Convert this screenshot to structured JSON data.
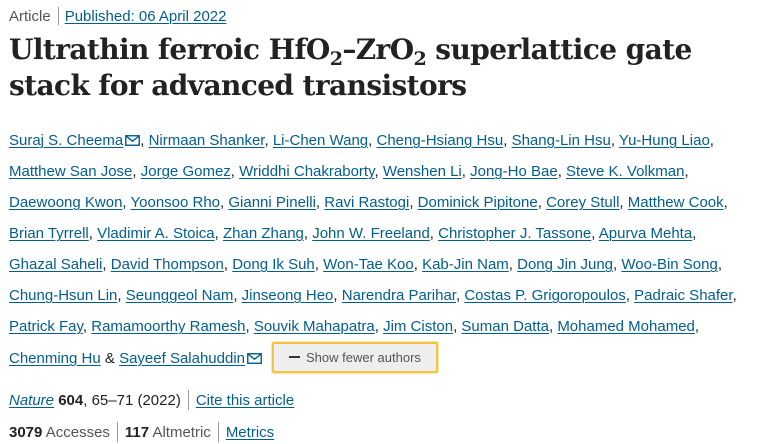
{
  "header": {
    "article_type": "Article",
    "published": "Published: 06 April 2022"
  },
  "title": {
    "part1": "Ultrathin ferroic HfO",
    "sub1": "2",
    "dash": "–",
    "part2": "ZrO",
    "sub2": "2",
    "part3": " superlattice gate stack for advanced transistors"
  },
  "authors": [
    {
      "name": "Suraj S. Cheema",
      "mail": true
    },
    {
      "name": "Nirmaan Shanker",
      "mail": false
    },
    {
      "name": "Li-Chen Wang",
      "mail": false
    },
    {
      "name": "Cheng-Hsiang Hsu",
      "mail": false
    },
    {
      "name": "Shang-Lin Hsu",
      "mail": false
    },
    {
      "name": "Yu-Hung Liao",
      "mail": false
    },
    {
      "name": "Matthew San Jose",
      "mail": false
    },
    {
      "name": "Jorge Gomez",
      "mail": false
    },
    {
      "name": "Wriddhi Chakraborty",
      "mail": false
    },
    {
      "name": "Wenshen Li",
      "mail": false
    },
    {
      "name": "Jong-Ho Bae",
      "mail": false
    },
    {
      "name": "Steve K. Volkman",
      "mail": false
    },
    {
      "name": "Daewoong Kwon",
      "mail": false
    },
    {
      "name": "Yoonsoo Rho",
      "mail": false
    },
    {
      "name": "Gianni Pinelli",
      "mail": false
    },
    {
      "name": "Ravi Rastogi",
      "mail": false
    },
    {
      "name": "Dominick Pipitone",
      "mail": false
    },
    {
      "name": "Corey Stull",
      "mail": false
    },
    {
      "name": "Matthew Cook",
      "mail": false
    },
    {
      "name": "Brian Tyrrell",
      "mail": false
    },
    {
      "name": "Vladimir A. Stoica",
      "mail": false
    },
    {
      "name": "Zhan Zhang",
      "mail": false
    },
    {
      "name": "John W. Freeland",
      "mail": false
    },
    {
      "name": "Christopher J. Tassone",
      "mail": false
    },
    {
      "name": "Apurva Mehta",
      "mail": false
    },
    {
      "name": "Ghazal Saheli",
      "mail": false
    },
    {
      "name": "David Thompson",
      "mail": false
    },
    {
      "name": "Dong Ik Suh",
      "mail": false
    },
    {
      "name": "Won-Tae Koo",
      "mail": false
    },
    {
      "name": "Kab-Jin Nam",
      "mail": false
    },
    {
      "name": "Dong Jin Jung",
      "mail": false
    },
    {
      "name": "Woo-Bin Song",
      "mail": false
    },
    {
      "name": "Chung-Hsun Lin",
      "mail": false
    },
    {
      "name": "Seunggeol Nam",
      "mail": false
    },
    {
      "name": "Jinseong Heo",
      "mail": false
    },
    {
      "name": "Narendra Parihar",
      "mail": false
    },
    {
      "name": "Costas P. Grigoropoulos",
      "mail": false
    },
    {
      "name": "Padraic Shafer",
      "mail": false
    },
    {
      "name": "Patrick Fay",
      "mail": false
    },
    {
      "name": "Ramamoorthy Ramesh",
      "mail": false
    },
    {
      "name": "Souvik Mahapatra",
      "mail": false
    },
    {
      "name": "Jim Ciston",
      "mail": false
    },
    {
      "name": "Suman Datta",
      "mail": false
    },
    {
      "name": "Mohamed Mohamed",
      "mail": false
    },
    {
      "name": "Chenming Hu",
      "mail": false
    },
    {
      "name": "Sayeef Salahuddin",
      "mail": true
    }
  ],
  "authors_separator": ",",
  "authors_final_join": "&",
  "show_fewer_label": "Show fewer authors",
  "citation": {
    "journal": "Nature",
    "volume": "604",
    "pages": ", 65–71 (2022)",
    "cite_label": "Cite this article"
  },
  "metrics": {
    "accesses_count": "3079",
    "accesses_label": "Accesses",
    "altmetric_count": "117",
    "altmetric_label": "Altmetric",
    "metrics_link": "Metrics"
  },
  "icons": {
    "mail": "envelope-icon",
    "show_fewer": "minus-icon"
  },
  "colors": {
    "link": "#025e8d",
    "text": "#222222",
    "muted": "#555555",
    "button_bg": "#eeeeee",
    "button_focus": "#f5c344"
  }
}
